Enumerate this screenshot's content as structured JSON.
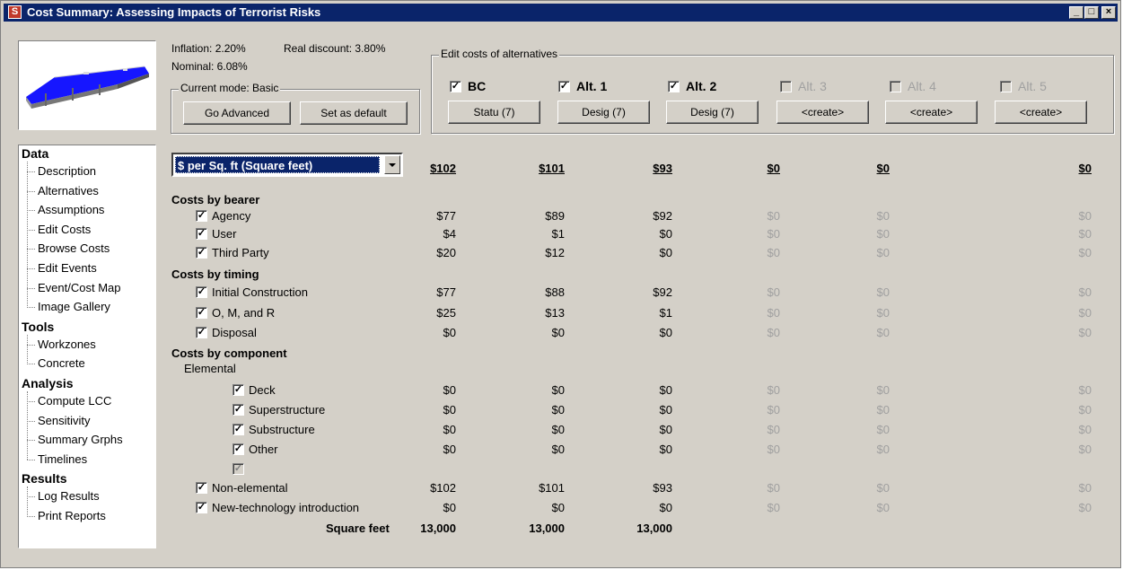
{
  "window": {
    "title": "Cost Summary: Assessing Impacts of Terrorist Risks"
  },
  "titlebar_buttons": [
    "minimize-icon",
    "maximize-icon",
    "close-icon"
  ],
  "rates": {
    "inflation": "Inflation: 2.20%",
    "real_discount": "Real discount: 3.80%",
    "nominal": "Nominal: 6.08%"
  },
  "mode": {
    "label": "Current mode: Basic",
    "go_advanced": "Go Advanced",
    "set_default": "Set as default"
  },
  "alternatives_group": {
    "label": "Edit costs of alternatives"
  },
  "alternatives": [
    {
      "name": "BC",
      "checked": true,
      "enabled": true,
      "button": "Statu (7)"
    },
    {
      "name": "Alt. 1",
      "checked": true,
      "enabled": true,
      "button": "Desig (7)"
    },
    {
      "name": "Alt. 2",
      "checked": true,
      "enabled": true,
      "button": "Desig (7)"
    },
    {
      "name": "Alt. 3",
      "checked": false,
      "enabled": false,
      "button": "<create>"
    },
    {
      "name": "Alt. 4",
      "checked": false,
      "enabled": false,
      "button": "<create>"
    },
    {
      "name": "Alt. 5",
      "checked": false,
      "enabled": false,
      "button": "<create>"
    }
  ],
  "tree": {
    "sections": [
      {
        "title": "Data",
        "items": [
          "Description",
          "Alternatives",
          "Assumptions",
          "Edit Costs",
          "Browse Costs",
          "Edit Events",
          "Event/Cost Map",
          "Image Gallery"
        ]
      },
      {
        "title": "Tools",
        "items": [
          "Workzones",
          "Concrete"
        ]
      },
      {
        "title": "Analysis",
        "items": [
          "Compute LCC",
          "Sensitivity",
          "Summary Grphs",
          "Timelines"
        ]
      },
      {
        "title": "Results",
        "items": [
          "Log Results",
          "Print Reports"
        ]
      }
    ]
  },
  "unit_select": {
    "value": "$ per Sq. ft (Square feet)"
  },
  "totals": [
    "$102",
    "$101",
    "$93",
    "$0",
    "$0",
    "$0"
  ],
  "sections": {
    "bearer": "Costs by bearer",
    "timing": "Costs by timing",
    "component": "Costs by component",
    "elemental": "Elemental"
  },
  "rows": {
    "agency": {
      "label": "Agency",
      "values": [
        "$77",
        "$89",
        "$92",
        "$0",
        "$0",
        "$0"
      ]
    },
    "user": {
      "label": "User",
      "values": [
        "$4",
        "$1",
        "$0",
        "$0",
        "$0",
        "$0"
      ]
    },
    "third_party": {
      "label": "Third Party",
      "values": [
        "$20",
        "$12",
        "$0",
        "$0",
        "$0",
        "$0"
      ]
    },
    "initial": {
      "label": "Initial Construction",
      "values": [
        "$77",
        "$88",
        "$92",
        "$0",
        "$0",
        "$0"
      ]
    },
    "omr": {
      "label": "O, M, and R",
      "values": [
        "$25",
        "$13",
        "$1",
        "$0",
        "$0",
        "$0"
      ]
    },
    "disposal": {
      "label": "Disposal",
      "values": [
        "$0",
        "$0",
        "$0",
        "$0",
        "$0",
        "$0"
      ]
    },
    "deck": {
      "label": "Deck",
      "values": [
        "$0",
        "$0",
        "$0",
        "$0",
        "$0",
        "$0"
      ]
    },
    "superstructure": {
      "label": "Superstructure",
      "values": [
        "$0",
        "$0",
        "$0",
        "$0",
        "$0",
        "$0"
      ]
    },
    "substructure": {
      "label": "Substructure",
      "values": [
        "$0",
        "$0",
        "$0",
        "$0",
        "$0",
        "$0"
      ]
    },
    "other": {
      "label": "Other",
      "values": [
        "$0",
        "$0",
        "$0",
        "$0",
        "$0",
        "$0"
      ]
    },
    "non_elemental": {
      "label": "Non-elemental",
      "values": [
        "$102",
        "$101",
        "$93",
        "$0",
        "$0",
        "$0"
      ]
    },
    "new_tech": {
      "label": "New-technology introduction",
      "values": [
        "$0",
        "$0",
        "$0",
        "$0",
        "$0",
        "$0"
      ]
    }
  },
  "square_feet": {
    "label": "Square feet",
    "values": [
      "13,000",
      "13,000",
      "13,000"
    ]
  },
  "check_mark": "✓"
}
